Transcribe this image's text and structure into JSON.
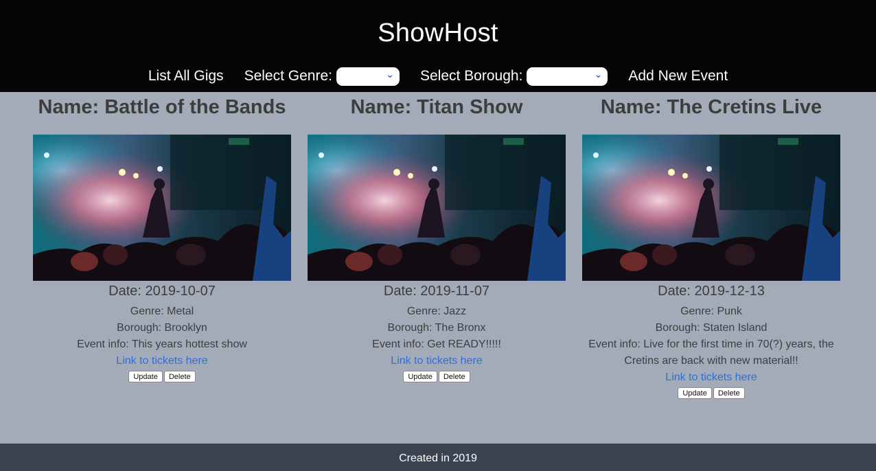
{
  "header": {
    "brand": "ShowHost",
    "nav": {
      "list_all": "List All Gigs",
      "select_genre_label": "Select Genre:",
      "select_borough_label": "Select Borough:",
      "add_new": "Add New Event"
    }
  },
  "colors": {
    "header_bg": "#050505",
    "page_bg": "#a3abb9",
    "footer_bg": "#3c4350",
    "link": "#2b71d8"
  },
  "cards": [
    {
      "name": "Name: Battle of the Bands",
      "date": "Date: 2019-10-07",
      "genre": "Genre: Metal",
      "borough": "Borough: Brooklyn",
      "info": "Event info: This years hottest show",
      "link": "Link to tickets here",
      "update": "Update",
      "delete": "Delete"
    },
    {
      "name": "Name: Titan Show",
      "date": "Date: 2019-11-07",
      "genre": "Genre: Jazz",
      "borough": "Borough: The Bronx",
      "info": "Event info: Get READY!!!!!",
      "link": "Link to tickets here",
      "update": "Update",
      "delete": "Delete"
    },
    {
      "name": "Name: The Cretins Live",
      "date": "Date: 2019-12-13",
      "genre": "Genre: Punk",
      "borough": "Borough: Staten Island",
      "info": "Event info: Live for the first time in 70(?) years, the Cretins are back with new material!!",
      "link": "Link to tickets here",
      "update": "Update",
      "delete": "Delete"
    }
  ],
  "footer": {
    "text": "Created in 2019"
  }
}
